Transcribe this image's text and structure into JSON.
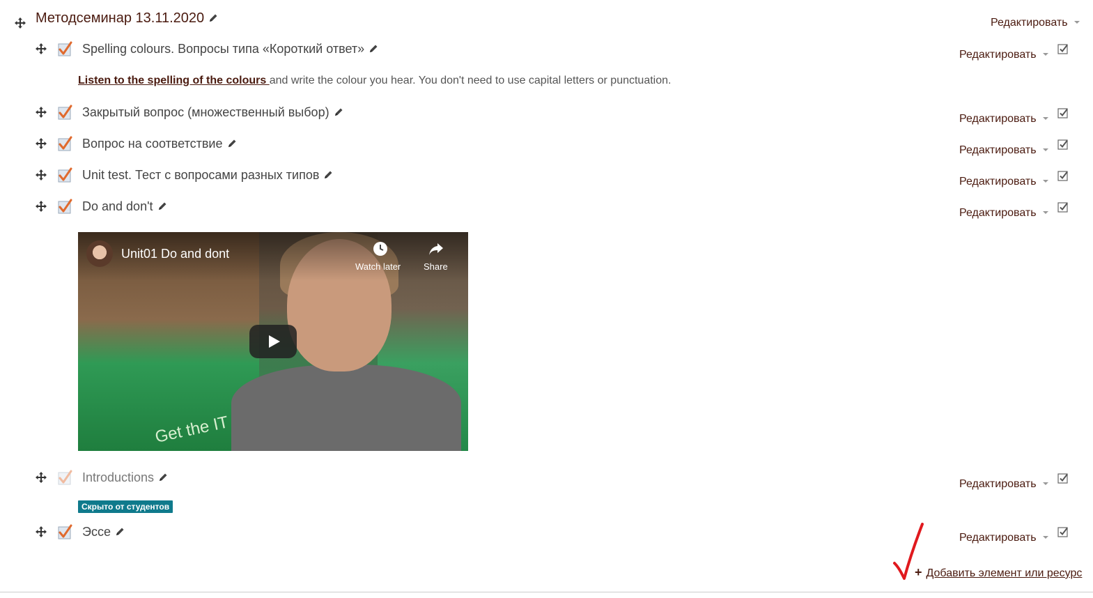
{
  "section": {
    "title": "Методсеминар 13.11.2020",
    "edit_label": "Редактировать"
  },
  "activities": [
    {
      "name": "Spelling colours. Вопросы типа «Короткий ответ»",
      "edit_label": "Редактировать"
    },
    {
      "name": "Закрытый вопрос (множественный выбор)",
      "edit_label": "Редактировать"
    },
    {
      "name": "Вопрос на соответствие",
      "edit_label": "Редактировать"
    },
    {
      "name": "Unit test. Тест с вопросами разных типов",
      "edit_label": "Редактировать"
    },
    {
      "name": "Do and don't",
      "edit_label": "Редактировать"
    },
    {
      "name": "Introductions",
      "edit_label": "Редактировать"
    },
    {
      "name": "Эссе",
      "edit_label": "Редактировать"
    }
  ],
  "description": {
    "link_text": "Listen to the spelling of the colours ",
    "text": "and write the colour you hear. You don't need to use capital letters or punctuation."
  },
  "video": {
    "title": "Unit01 Do and dont",
    "watch_later_label": "Watch later",
    "share_label": "Share",
    "overlay_text": "Get the IT"
  },
  "hidden_badge": "Скрыто от студентов",
  "add_activity_label": "Добавить элемент или ресурс",
  "colors": {
    "accent": "#4a1a0f",
    "badge": "#0f7a8c",
    "quiz_check": "#e06a2e",
    "annotation_check": "#e0191e"
  },
  "icons": [
    "move-icon",
    "quiz-icon",
    "pencil-icon",
    "checkbox-icon",
    "clock-icon",
    "share-icon",
    "play-icon",
    "plus-icon"
  ]
}
